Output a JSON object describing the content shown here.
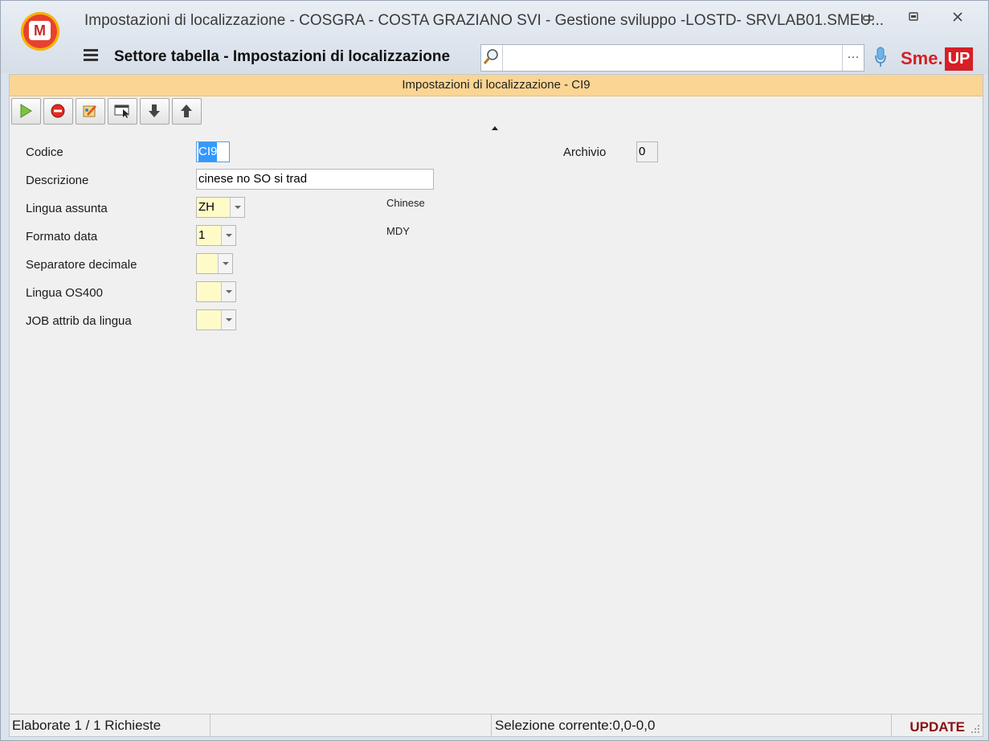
{
  "window": {
    "title": "Impostazioni di localizzazione - COSGRA - COSTA GRAZIANO SVI - Gestione sviluppo -LOSTD- SRVLAB01.SMEU...",
    "logo_text": "M",
    "controls": [
      "minimize-icon",
      "restore-icon",
      "close-icon"
    ]
  },
  "header": {
    "title": "Settore tabella - Impostazioni di localizzazione",
    "search": {
      "value": "",
      "placeholder": ""
    },
    "more_label": "···",
    "brand": {
      "sme": "Sme.",
      "up": "UP",
      "color": "#d61f26"
    }
  },
  "panel": {
    "title": "Impostazioni di localizzazione - CI9",
    "header_color": "#fad593"
  },
  "toolbar": {
    "buttons": [
      "confirm-icon",
      "cancel-icon",
      "edit-icon",
      "select-icon",
      "arrow-down-icon",
      "arrow-up-icon"
    ]
  },
  "form": {
    "codice": {
      "label": "Codice",
      "value": "CI9"
    },
    "archivio": {
      "label": "Archivio",
      "value": "0"
    },
    "descrizione": {
      "label": "Descrizione",
      "value": "cinese no SO si trad"
    },
    "lingua_assunta": {
      "label": "Lingua assunta",
      "value": "ZH",
      "description": "Chinese"
    },
    "formato_data": {
      "label": "Formato data",
      "value": "1",
      "description": "MDY"
    },
    "separatore_decimale": {
      "label": "Separatore decimale",
      "value": ""
    },
    "lingua_os400": {
      "label": "Lingua OS400",
      "value": ""
    },
    "job_attrib": {
      "label": "JOB attrib da lingua",
      "value": ""
    }
  },
  "status": {
    "left": "Elaborate 1 / 1 Richieste",
    "selection": "Selezione corrente:0,0-0,0",
    "mode": "UPDATE"
  }
}
